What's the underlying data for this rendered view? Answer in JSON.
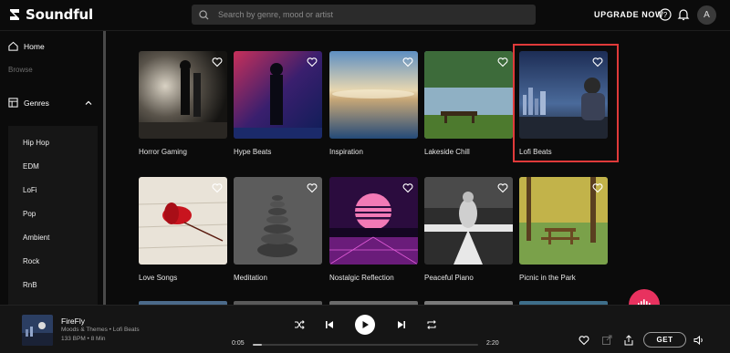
{
  "app": {
    "name": "Soundful"
  },
  "header": {
    "search_placeholder": "Search by genre, mood or artist",
    "upgrade_label": "UPGRADE NOW",
    "avatar_initial": "A",
    "icons": [
      "search-icon",
      "help-icon",
      "bell-icon"
    ]
  },
  "sidebar": {
    "home_label": "Home",
    "browse_label": "Browse",
    "genres_label": "Genres",
    "genres": [
      "Hip Hop",
      "EDM",
      "LoFi",
      "Pop",
      "Ambient",
      "Rock",
      "RnB"
    ]
  },
  "grid": {
    "cards": [
      {
        "title": "Horror Gaming"
      },
      {
        "title": "Hype Beats"
      },
      {
        "title": "Inspiration"
      },
      {
        "title": "Lakeside Chill"
      },
      {
        "title": "Lofi Beats",
        "selected": true
      },
      {
        "title": "Love Songs"
      },
      {
        "title": "Meditation"
      },
      {
        "title": "Nostalgic Reflection"
      },
      {
        "title": "Peaceful Piano"
      },
      {
        "title": "Picnic in the Park"
      }
    ]
  },
  "player": {
    "title": "FireFly",
    "subtitle": "Moods & Themes • Lofi Beats",
    "meta": "133 BPM • 8 Min",
    "time_current": "0:05",
    "time_total": "2:20",
    "progress": 0.04,
    "get_label": "GET"
  },
  "colors": {
    "accent": "#e8325f",
    "selection": "#e03a3a",
    "background": "#0b0b0b"
  }
}
